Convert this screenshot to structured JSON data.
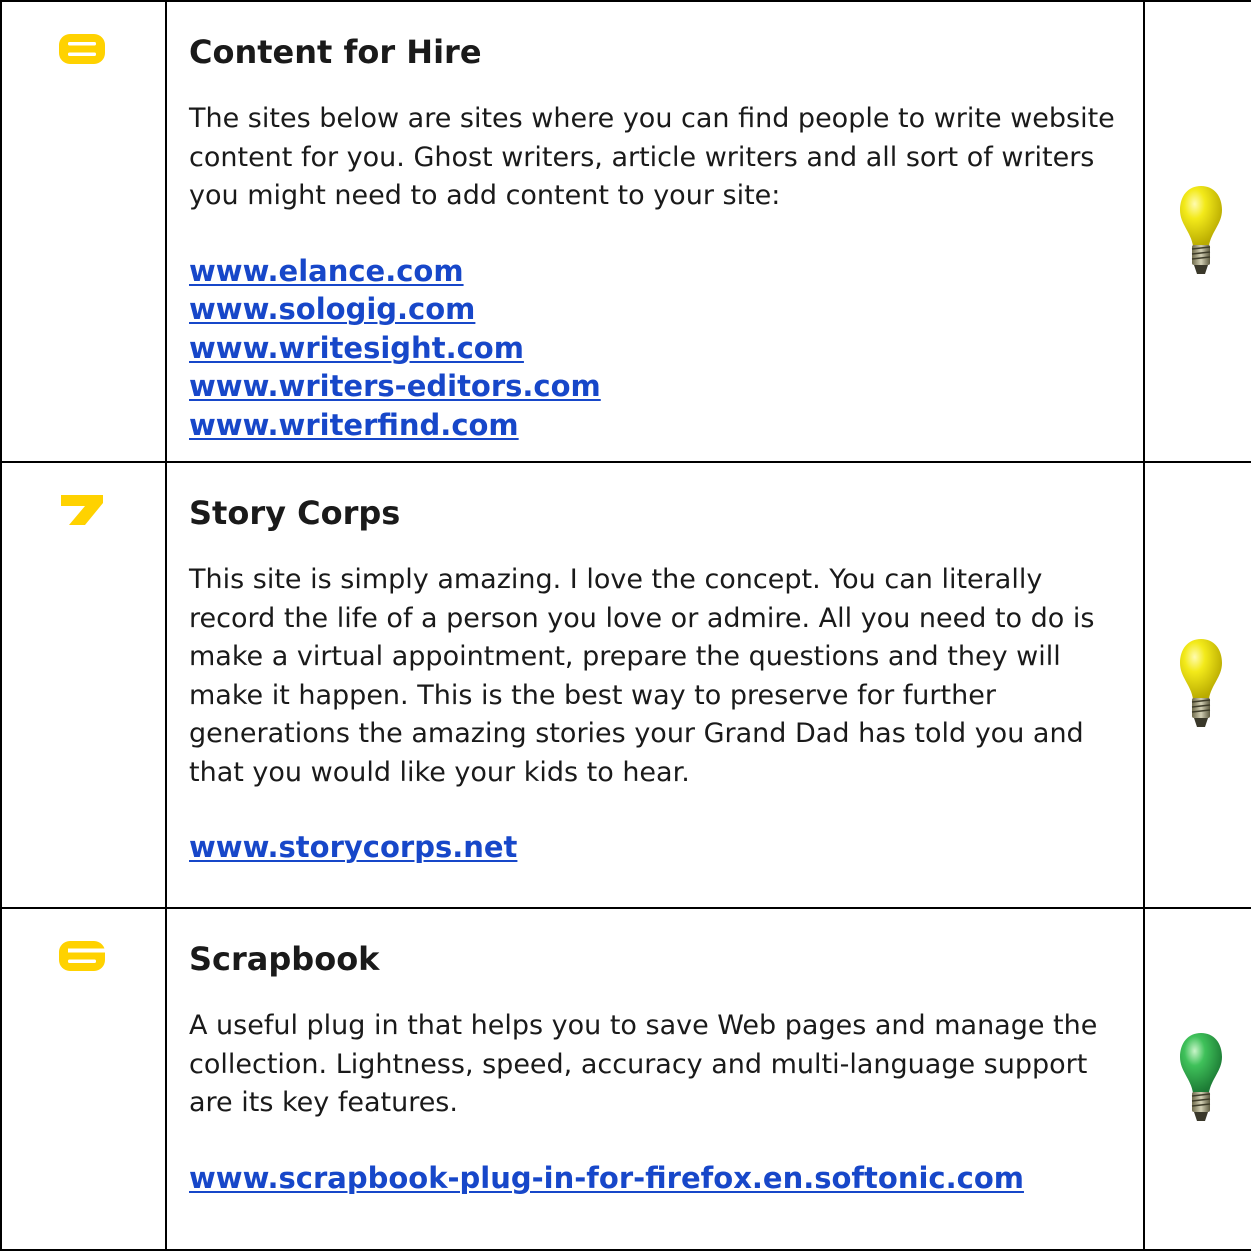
{
  "colors": {
    "number_badge": "#ffd200",
    "link": "#1747c9",
    "bulb_yellow": "#f1e713",
    "bulb_green": "#2fbf55"
  },
  "items": [
    {
      "number": "8",
      "title": "Content for Hire",
      "description": "The sites below are sites where you can find people to write website content for you. Ghost writers, article writers and all sort of writers you might need to add content to your site:",
      "links": [
        "www.elance.com",
        "www.sologig.com",
        "www.writesight.com",
        "www.writers-editors.com",
        "www.writerfind.com"
      ],
      "bulb_color": "yellow"
    },
    {
      "number": "7",
      "title": "Story Corps",
      "description": "This site is simply amazing. I love the concept. You can literally record the life of a person you love or admire. All you need to do is make a virtual appointment, prepare the questions and they will make it happen. This is the best way to preserve for further generations the amazing stories your Grand Dad has told you and that you would like your kids to hear.",
      "links": [
        "www.storycorps.net"
      ],
      "bulb_color": "yellow"
    },
    {
      "number": "6",
      "title": "Scrapbook",
      "description": "A useful plug in that helps you to save Web pages and manage the collection. Lightness, speed, accuracy and multi-language support are its key features.",
      "links": [
        "www.scrapbook-plug-in-for-firefox.en.softonic.com"
      ],
      "bulb_color": "green"
    }
  ]
}
